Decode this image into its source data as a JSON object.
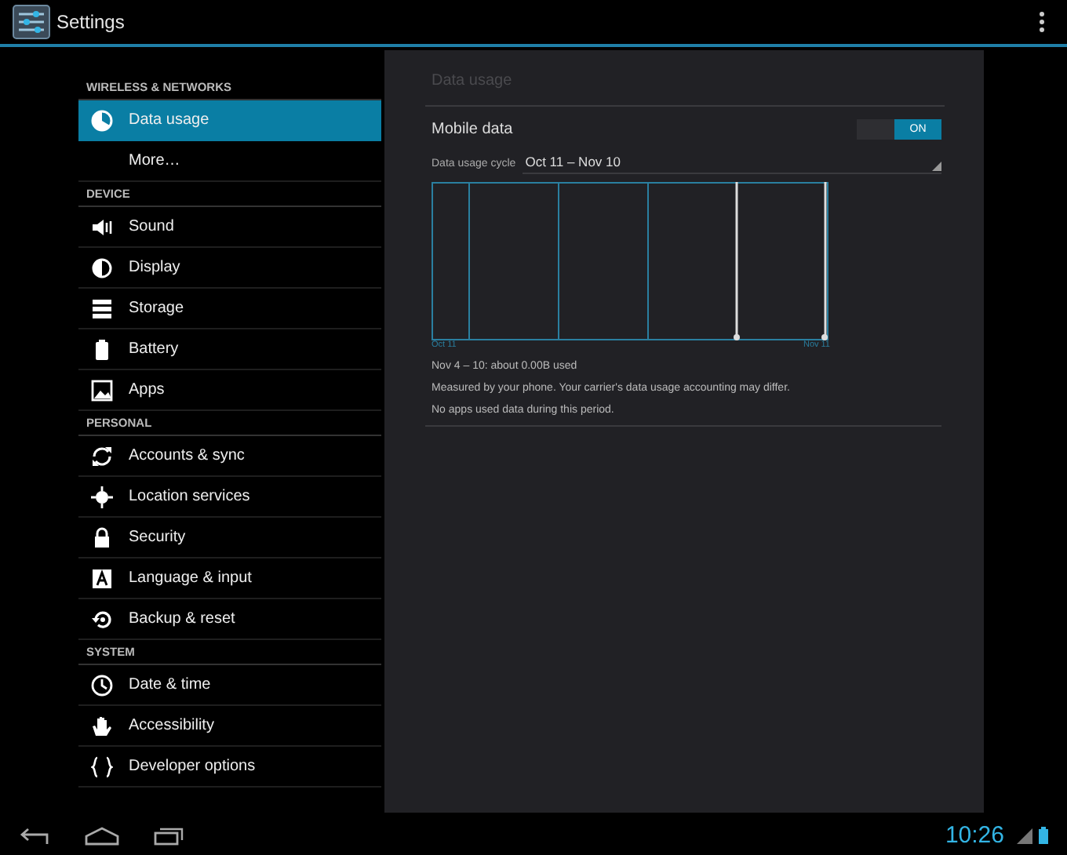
{
  "action_bar": {
    "title": "Settings"
  },
  "sidebar": {
    "sections": [
      {
        "header": "WIRELESS & NETWORKS",
        "items": [
          {
            "label": "Data usage",
            "kind": "pie",
            "selected": true
          },
          {
            "label": "More…",
            "kind": "none",
            "selected": false
          }
        ]
      },
      {
        "header": "DEVICE",
        "items": [
          {
            "label": "Sound",
            "kind": "sound",
            "selected": false
          },
          {
            "label": "Display",
            "kind": "display",
            "selected": false
          },
          {
            "label": "Storage",
            "kind": "storage",
            "selected": false
          },
          {
            "label": "Battery",
            "kind": "battery",
            "selected": false
          },
          {
            "label": "Apps",
            "kind": "apps",
            "selected": false
          }
        ]
      },
      {
        "header": "PERSONAL",
        "items": [
          {
            "label": "Accounts & sync",
            "kind": "sync",
            "selected": false
          },
          {
            "label": "Location services",
            "kind": "location",
            "selected": false
          },
          {
            "label": "Security",
            "kind": "lock",
            "selected": false
          },
          {
            "label": "Language & input",
            "kind": "language",
            "selected": false
          },
          {
            "label": "Backup & reset",
            "kind": "backup",
            "selected": false
          }
        ]
      },
      {
        "header": "SYSTEM",
        "items": [
          {
            "label": "Date & time",
            "kind": "clock",
            "selected": false
          },
          {
            "label": "Accessibility",
            "kind": "hand",
            "selected": false
          },
          {
            "label": "Developer options",
            "kind": "braces",
            "selected": false
          }
        ]
      }
    ]
  },
  "detail": {
    "title": "Data usage",
    "mobile_data": {
      "label": "Mobile data",
      "on": true,
      "toggle_text": "ON"
    },
    "cycle": {
      "label": "Data usage cycle",
      "value": "Oct 11 – Nov 10"
    },
    "graph": {
      "start_label": "Oct 11",
      "end_label": "Nov 11"
    },
    "summary": "Nov 4 – 10: about 0.00B used",
    "note": "Measured by your phone. Your carrier's data usage accounting may differ.",
    "empty_message": "No apps used data during this period."
  },
  "status_bar": {
    "time": "10:26"
  }
}
